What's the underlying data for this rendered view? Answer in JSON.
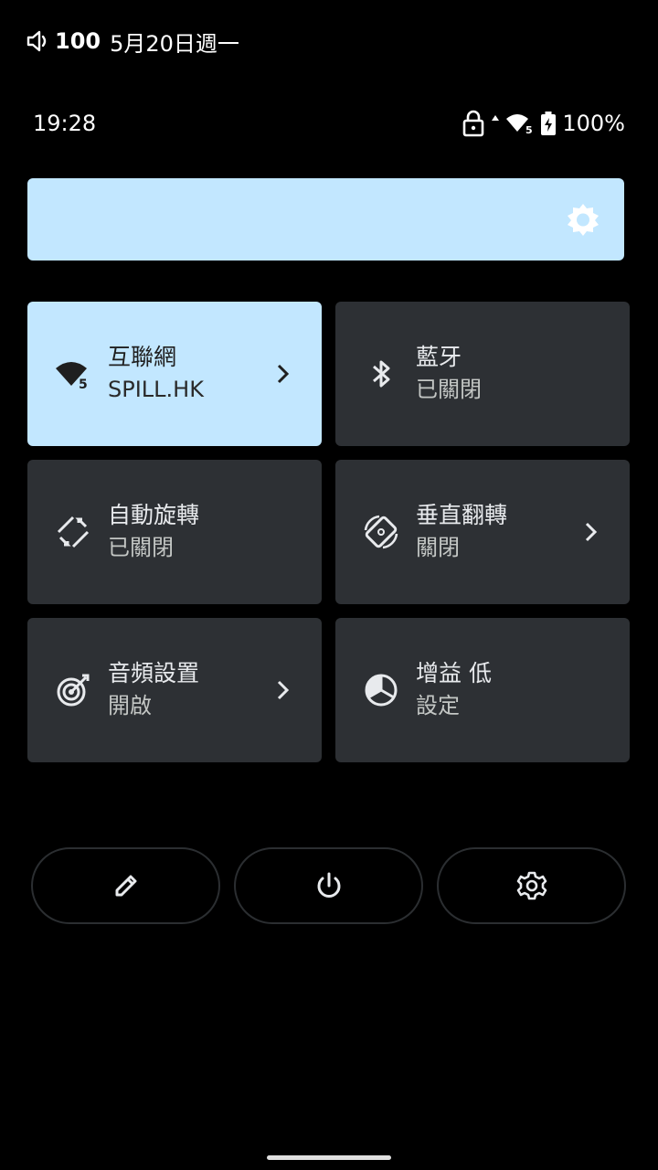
{
  "top": {
    "volume": "100",
    "date": "5月20日週一"
  },
  "status": {
    "time": "19:28",
    "battery": "100%",
    "wifi_badge": "5"
  },
  "tiles": [
    {
      "title": "互聯網",
      "subtitle": "SPILL.HK",
      "icon": "wifi-5-icon",
      "active": true,
      "chevron": true,
      "badge": "5"
    },
    {
      "title": "藍牙",
      "subtitle": "已關閉",
      "icon": "bluetooth-icon",
      "active": false,
      "chevron": false
    },
    {
      "title": "自動旋轉",
      "subtitle": "已關閉",
      "icon": "auto-rotate-icon",
      "active": false,
      "chevron": false
    },
    {
      "title": "垂直翻轉",
      "subtitle": "關閉",
      "icon": "vertical-flip-icon",
      "active": false,
      "chevron": true
    },
    {
      "title": "音頻設置",
      "subtitle": "開啟",
      "icon": "audio-settings-icon",
      "active": false,
      "chevron": true
    },
    {
      "title": "增益 低",
      "subtitle": "設定",
      "icon": "gain-icon",
      "active": false,
      "chevron": false
    }
  ],
  "buttons": [
    {
      "icon": "edit-pencil-icon"
    },
    {
      "icon": "power-icon"
    },
    {
      "icon": "settings-gear-icon"
    }
  ],
  "colors": {
    "accent": "#c2e7ff",
    "tile_bg": "#2d3034",
    "background": "#000000"
  }
}
